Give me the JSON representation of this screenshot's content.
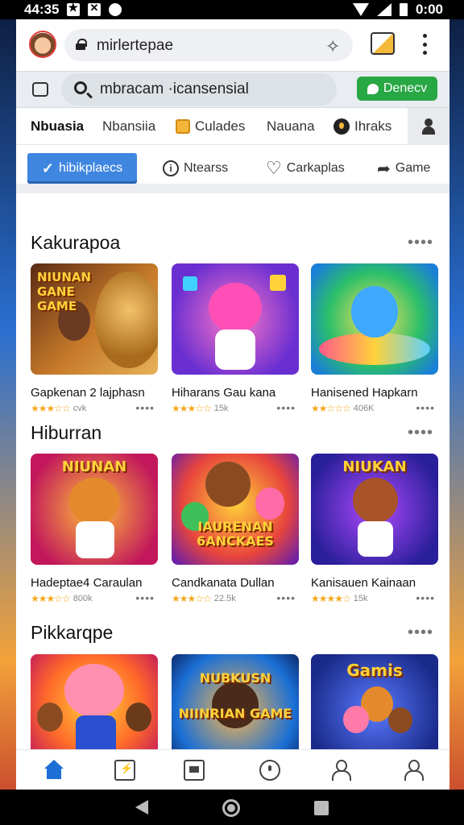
{
  "status": {
    "time": "44:35",
    "clock": "0:00"
  },
  "browser": {
    "url": "mirlertepae",
    "search_text": "mbracam ·icansensial",
    "action_button": "Denecv"
  },
  "tabs": [
    {
      "label": "Nbuasia",
      "icon": ""
    },
    {
      "label": "Nbansiia",
      "icon": ""
    },
    {
      "label": "Culades",
      "icon": "square-icon"
    },
    {
      "label": "Nauana",
      "icon": ""
    },
    {
      "label": "Ihraks",
      "icon": "dot-icon"
    }
  ],
  "filters": [
    {
      "label": "hibikplaecs",
      "icon": "check-icon"
    },
    {
      "label": "Ntearss",
      "icon": "info-icon"
    },
    {
      "label": "Carkaplas",
      "icon": "heart-icon"
    },
    {
      "label": "Game",
      "icon": "share-icon"
    }
  ],
  "sections": [
    {
      "title": "Kakurapoa",
      "more": "••••",
      "cards": [
        {
          "title": "Gapkenan 2 lajphasn",
          "stars": "★★★☆☆",
          "meta": "cvk",
          "art": "NIUNAN GANE GAME",
          "dots": "••••"
        },
        {
          "title": "Hiharans Gau kana",
          "stars": "★★★☆☆",
          "meta": "15k",
          "art": "",
          "dots": "••••"
        },
        {
          "title": "Hanisened Hapkarn",
          "stars": "★★☆☆☆",
          "meta": "406K",
          "art": "",
          "dots": "••••"
        }
      ]
    },
    {
      "title": "Hiburran",
      "more": "••••",
      "cards": [
        {
          "title": "Hadeptae4 Caraulan",
          "stars": "★★★☆☆",
          "meta": "800k",
          "art": "NIUNAN",
          "dots": "••••"
        },
        {
          "title": "Candkanata Dullan",
          "stars": "★★★☆☆",
          "meta": "22.5k",
          "art": "IAURENAN 6ANCKAES",
          "dots": "••••"
        },
        {
          "title": "Kanisauen Kainaan",
          "stars": "★★★★☆",
          "meta": "15k",
          "art": "NIUKAN",
          "dots": "••••"
        }
      ]
    },
    {
      "title": "Pikkarqpe",
      "more": "••••",
      "cards": [
        {
          "title": "",
          "stars": "",
          "meta": "",
          "art": "",
          "dots": ""
        },
        {
          "title": "",
          "stars": "",
          "meta": "",
          "art": "NUBKUSN NIINRIAN GAME",
          "dots": ""
        },
        {
          "title": "",
          "stars": "",
          "meta": "",
          "art": "Gamis",
          "dots": ""
        }
      ]
    }
  ],
  "bottom_nav": [
    "home-icon",
    "bolt-icon",
    "square-icon",
    "face-icon",
    "user-icon",
    "profile-icon"
  ],
  "colors": {
    "accent": "#3f86e0",
    "green": "#28a745",
    "star": "#f3a81c"
  }
}
